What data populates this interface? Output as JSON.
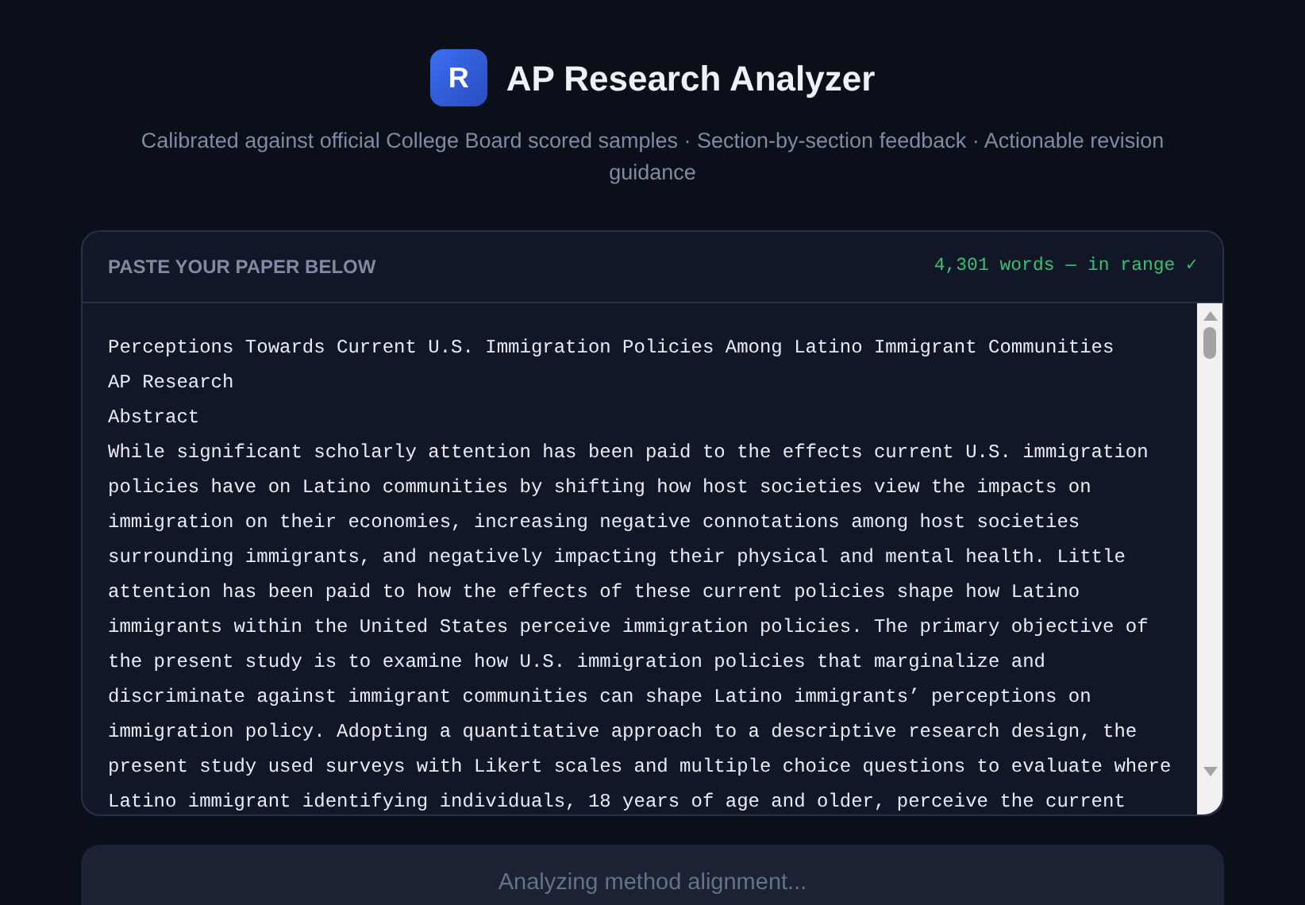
{
  "header": {
    "logo_letter": "R",
    "title": "AP Research Analyzer",
    "subtitle": "Calibrated against official College Board scored samples · Section-by-section feedback · Actionable revision guidance"
  },
  "paper": {
    "label": "PASTE YOUR PAPER BELOW",
    "word_count": "4,301 words — in range ✓",
    "lines": [
      "Perceptions Towards Current U.S. Immigration Policies Among Latino Immigrant Communities",
      "AP Research",
      "Abstract",
      "While significant scholarly attention has been paid to the effects current U.S. immigration",
      "policies have on Latino communities by shifting how host societies view the impacts on",
      "immigration on their economies, increasing negative connotations among host societies",
      "surrounding immigrants, and negatively impacting their physical and mental health. Little",
      "attention has been paid to how the effects of these current policies shape how Latino",
      "immigrants within the United States perceive immigration policies. The primary objective of",
      "the present study is to examine how U.S. immigration policies that marginalize and",
      "discriminate against immigrant communities can shape Latino immigrants’ perceptions on",
      "immigration policy. Adopting a quantitative approach to a descriptive research design, the",
      "present study used surveys with Likert scales and multiple choice questions to evaluate where",
      "Latino immigrant identifying individuals, 18 years of age and older, perceive the current"
    ]
  },
  "status_button": {
    "label": "Analyzing method alignment...",
    "disabled": true
  }
}
